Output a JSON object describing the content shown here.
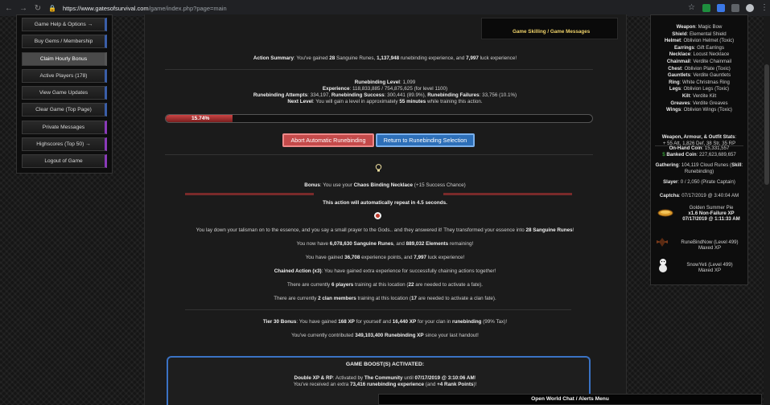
{
  "browser": {
    "url_host": "https://www.gatesofsurvival.com",
    "url_path": "/game/index.php?page=main"
  },
  "left_menu": [
    {
      "label": "Game Help & Options →"
    },
    {
      "label": "Buy Gems / Membership"
    },
    {
      "label": "Claim Hourly Bonus"
    },
    {
      "label": "Active Players (178)"
    },
    {
      "label": "View Game Updates"
    },
    {
      "label": "Clear Game (Top Page)"
    },
    {
      "label": "Private Messages"
    },
    {
      "label": "Highscores (Top 50) →"
    },
    {
      "label": "Logout of Game"
    }
  ],
  "topbar": {
    "label": "Game Skilling / Game Messages"
  },
  "action_summary": {
    "prefix": "Action Summary",
    "t1": ": You've gained ",
    "runes": "28",
    "t2": " Sanguine Runes, ",
    "xp": "1,137,948",
    "t3": " runebinding experience, and ",
    "luck": "7,997",
    "t4": " luck experience!"
  },
  "skill": {
    "level_label": "Runebinding Level",
    "level": "1,099",
    "experience_label": "Experience",
    "experience": "118,833,885 / 754,875,625 (for level 1100)",
    "attempts_label": "Runebinding Attempts",
    "attempts": "334,197",
    "success_label": "Runebinding Success",
    "success": "300,441 (89.9%)",
    "failures_label": "Runebinding Failures",
    "failures": "33,756 (10.1%)",
    "next_label": "Next Level",
    "next_prefix": ": You will gain a level in approximately ",
    "next_time": "55 minutes",
    "next_suffix": " while training this action."
  },
  "progress": {
    "label": "15.74%",
    "value": 15.74
  },
  "buttons": {
    "abort": "Abort Automatic Runebinding",
    "return": "Return to Runebinding Selection"
  },
  "bonus": {
    "prefix": "Bonus",
    "t1": ": You use your ",
    "item": "Chaos Binding Necklace",
    "t2": " (+15 Success Chance)"
  },
  "repeat": {
    "t1": "This action will automatically repeat in ",
    "time": "4.5 seconds",
    "t2": "."
  },
  "messages": {
    "m1_a": "You lay down your talisman on to the essence, and you say a small prayer to the Gods.. and they answered it! They transformed your essence into ",
    "m1_b": "28 Sanguine Runes",
    "m1_c": "!",
    "m2_a": "You now have ",
    "m2_b": "6,078,630 Sanguine Runes",
    "m2_c": ", and ",
    "m2_d": "889,032 Elements",
    "m2_e": " remaining!",
    "m3_a": "You have gained ",
    "m3_b": "36,708",
    "m3_c": " experience points, and ",
    "m3_d": "7,997",
    "m3_e": " luck experience!",
    "m4_a": "Chained Action (x3)",
    "m4_b": ": You have gained extra experience for successfully chaining actions together!",
    "m5_a": "There are currently ",
    "m5_b": "6 players",
    "m5_c": " training at this location (",
    "m5_d": "22",
    "m5_e": " are needed to activate a fate).",
    "m6_a": "There are currently ",
    "m6_b": "2 clan members",
    "m6_c": " training at this location (",
    "m6_d": "17",
    "m6_e": " are needed to activate a clan fate).",
    "m7_a": "Tier 30 Bonus",
    "m7_b": ": You have gained ",
    "m7_c": "168 XP",
    "m7_d": " for yourself and ",
    "m7_e": "16,440 XP",
    "m7_f": " for your clan in ",
    "m7_g": "runebinding",
    "m7_h": " (99% Tax)!",
    "m8_a": "You've currently contributed ",
    "m8_b": "349,103,400 Runebinding XP",
    "m8_c": " since your last handout!"
  },
  "boost": {
    "title": "GAME BOOST(S) ACTIVATED:",
    "l1_a": "Double XP & RP",
    "l1_b": ": Activated by ",
    "l1_c": "The Community",
    "l1_d": " until ",
    "l1_e": "07/17/2019 @ 3:10:06 AM",
    "l1_f": "!",
    "l2_a": "You've received an extra ",
    "l2_b": "73,416 runebinding experience",
    "l2_c": " (and ",
    "l2_d": "+4 Rank Points",
    "l2_e": ")!"
  },
  "equipment": [
    {
      "slot": "Weapon",
      "item": "Magic Bow"
    },
    {
      "slot": "Shield",
      "item": "Elemental Shield"
    },
    {
      "slot": "Helmet",
      "item": "Oblivion Helmet (Toxic)"
    },
    {
      "slot": "Earrings",
      "item": "Gift Earrings"
    },
    {
      "slot": "Necklace",
      "item": "Locust Necklace"
    },
    {
      "slot": "Chainmail",
      "item": "Verdite Chainmail"
    },
    {
      "slot": "Chest",
      "item": "Oblivion Plate (Toxic)"
    },
    {
      "slot": "Gauntlets",
      "item": "Verdite Gauntlets"
    },
    {
      "slot": "Ring",
      "item": "White Christmas Ring"
    },
    {
      "slot": "Legs",
      "item": "Oblivion Legs (Toxic)"
    },
    {
      "slot": "Kilt",
      "item": "Verdite Kilt"
    },
    {
      "slot": "Greaves",
      "item": "Verdite Greaves"
    },
    {
      "slot": "Wings",
      "item": "Oblivion Wings (Toxic)"
    }
  ],
  "stats": {
    "title": "Weapon, Armour, & Outfit Stats",
    "values": "+ 55 Att, 1,826 Def, 38 Str, 35 RP"
  },
  "coins": {
    "onhand_label": "On-Hand Coin",
    "onhand": "15,331,557",
    "banked_label": "Banked Coin",
    "banked": "227,623,689,657"
  },
  "gathering": {
    "label": "Gathering",
    "value": "104,119 Cloud Runes (",
    "skill_label": "Skill",
    "skill": "Runebinding)"
  },
  "slayer": {
    "label": "Slayer",
    "value": "0 / 2,050 (Pirate Captain)"
  },
  "captcha": {
    "label": "Captcha",
    "value": "07/17/2019 @ 3:40:04 AM"
  },
  "pie": {
    "name": "Golden Summer Pie",
    "xp": "x1.6 Non-Failure XP",
    "until": "07/17/2019 @ 1:11:33 AM"
  },
  "pets": [
    {
      "name": "RuneBindNow (Level 499)",
      "status": "Maxed XP"
    },
    {
      "name": "SnowYeti (Level 499)",
      "status": "Maxed XP"
    }
  ],
  "chat": {
    "label": "Open World Chat / Alerts Menu"
  },
  "colors": {
    "accent_gold": "#f0d36a",
    "button_red": "#c44a4a",
    "button_blue": "#2d6fb8",
    "boost_border": "#3a72c4",
    "coin_green": "#3fbf3f"
  }
}
